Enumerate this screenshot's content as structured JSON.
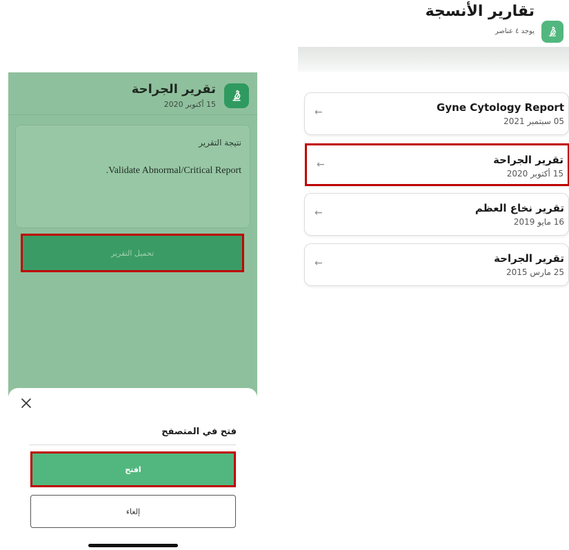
{
  "left": {
    "header": {
      "title": "تقرير الجراحة",
      "date": "15 أكتوبر 2020",
      "icon": "microscope-icon"
    },
    "result": {
      "label": "نتيجة التقرير",
      "text": ".Validate Abnormal/Critical Report"
    },
    "download_label": "تحميل التقرير",
    "sheet": {
      "title": "فتح في المتصفح",
      "open_label": "افتح",
      "cancel_label": "إلغاء",
      "close_icon": "close-icon"
    }
  },
  "right": {
    "header": {
      "title": "تقارير الأنسجة",
      "subtitle": "يوجد ٤ عناصر",
      "icon": "microscope-icon"
    },
    "reports": [
      {
        "title": "Gyne Cytology Report",
        "date": "05 سبتمبر 2021"
      },
      {
        "title": "تقرير الجراحة",
        "date": "15 أكتوبر 2020"
      },
      {
        "title": "تقرير نخاع العظم",
        "date": "16 مايو 2019"
      },
      {
        "title": "تقرير الجراحة",
        "date": "25 مارس 2015"
      }
    ]
  },
  "colors": {
    "brand_green": "#52b77e",
    "highlight_red": "#c00000",
    "overlay_green": "#8fc09d"
  }
}
